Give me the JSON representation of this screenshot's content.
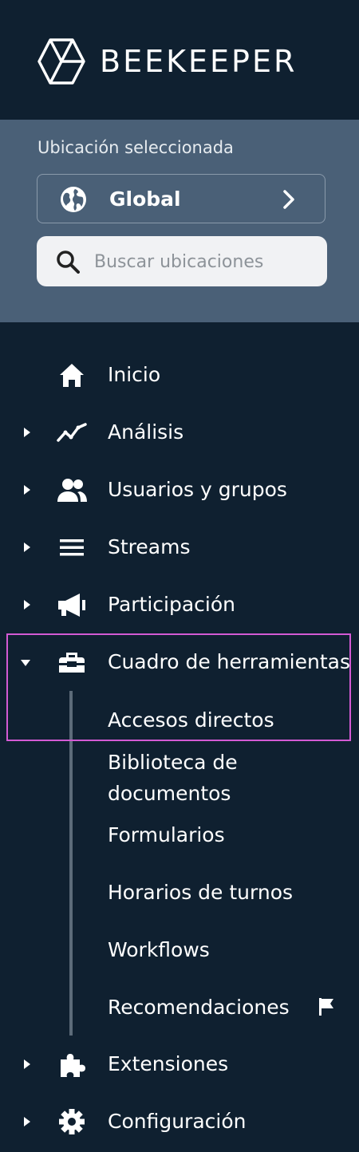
{
  "brand": {
    "name": "BEEKEEPER"
  },
  "location": {
    "label": "Ubicación seleccionada",
    "selected": "Global",
    "search_placeholder": "Buscar ubicaciones"
  },
  "nav": {
    "home": "Inicio",
    "analytics": "Análisis",
    "users": "Usuarios y grupos",
    "streams": "Streams",
    "engagement": "Participación",
    "toolbox": "Cuadro de herramientas",
    "extensions": "Extensiones",
    "settings": "Configuración"
  },
  "toolbox_items": {
    "shortcuts": "Accesos directos",
    "doc_library_line1": "Biblioteca de",
    "doc_library_line2": "documentos",
    "forms": "Formularios",
    "shift_schedules": "Horarios de turnos",
    "workflows": "Workflows",
    "recommendations": "Recomendaciones"
  },
  "colors": {
    "sidebar_bg": "#0f2030",
    "location_panel_bg": "#4a6077",
    "highlight_border": "#d35ad4"
  }
}
